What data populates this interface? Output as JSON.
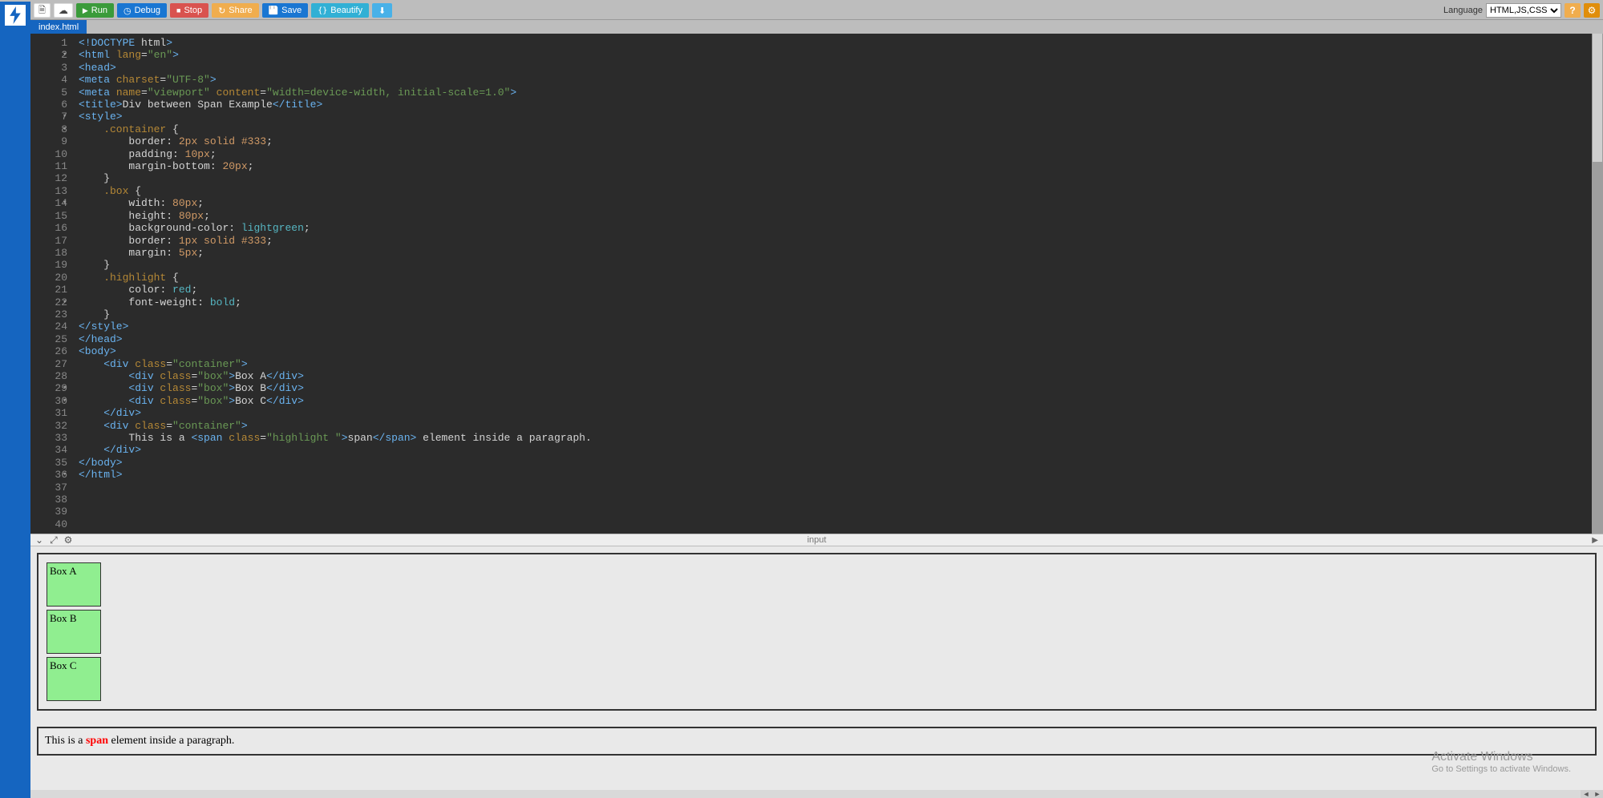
{
  "toolbar": {
    "new_label": "",
    "cloud_label": "",
    "run_label": "Run",
    "debug_label": "Debug",
    "stop_label": "Stop",
    "share_label": "Share",
    "save_label": "Save",
    "beautify_label": "Beautify",
    "download_label": "",
    "language_label": "Language",
    "language_value": "HTML,JS,CSS"
  },
  "tab": {
    "filename": "index.html"
  },
  "mid": {
    "input_label": "input"
  },
  "gutter": "1\n2\n3\n4\n5\n6\n7\n8\n9\n10\n11\n12\n13\n14\n15\n16\n17\n18\n19\n20\n21\n22\n23\n24\n25\n26\n27\n28\n29\n30\n31\n32\n33\n34\n35\n36\n37\n38\n39\n40",
  "code": {
    "l1": {
      "a": "<!DOCTYPE ",
      "b": "html",
      "c": ">"
    },
    "l2": {
      "a": "<html ",
      "b": "lang",
      "c": "=",
      "d": "\"en\"",
      "e": ">"
    },
    "l3": "<head>",
    "l4": {
      "a": "<meta ",
      "b": "charset",
      "d": "\"UTF-8\"",
      "e": ">"
    },
    "l5": {
      "a": "<meta ",
      "b": "name",
      "d": "\"viewport\"",
      "b2": "content",
      "d2": "\"width=device-width, initial-scale=1.0\"",
      "e": ">"
    },
    "l6": {
      "a": "<title>",
      "t": "Div between Span Example",
      "c": "</title>"
    },
    "l7": "<style>",
    "l8": {
      "s": "    .container ",
      "b": "{"
    },
    "l9": {
      "i": "        ",
      "p": "border",
      "v": "2px solid #333",
      "semi": ";"
    },
    "l10": {
      "i": "        ",
      "p": "padding",
      "v": "10px",
      "semi": ";"
    },
    "l11": {
      "i": "        ",
      "p": "margin-bottom",
      "v": "20px",
      "semi": ";"
    },
    "l12": "    }",
    "l13": "",
    "l14": {
      "s": "    .box ",
      "b": "{"
    },
    "l15": {
      "i": "        ",
      "p": "width",
      "v": "80px",
      "semi": ";"
    },
    "l16": {
      "i": "        ",
      "p": "height",
      "v": "80px",
      "semi": ";"
    },
    "l17": {
      "i": "        ",
      "p": "background-color",
      "v": "lightgreen",
      "semi": ";"
    },
    "l18": {
      "i": "        ",
      "p": "border",
      "v": "1px solid #333",
      "semi": ";"
    },
    "l19": {
      "i": "        ",
      "p": "margin",
      "v": "5px",
      "semi": ";"
    },
    "l20": "    }",
    "l21": "",
    "l22": {
      "s": "    .highlight ",
      "b": "{"
    },
    "l23": {
      "i": "        ",
      "p": "color",
      "v": "red",
      "semi": ";"
    },
    "l24": {
      "i": "        ",
      "p": "font-weight",
      "v": "bold",
      "semi": ";"
    },
    "l25": "    }",
    "l26": "",
    "l27": "</style>",
    "l28": "</head>",
    "l29": "<body>",
    "l30": {
      "a": "    <div ",
      "b": "class",
      "d": "\"container\"",
      "e": ">"
    },
    "l31": {
      "a": "        <div ",
      "b": "class",
      "d": "\"box\"",
      "e": ">",
      "t": "Box A",
      "c": "</div>"
    },
    "l32": {
      "a": "        <div ",
      "b": "class",
      "d": "\"box\"",
      "e": ">",
      "t": "Box B",
      "c": "</div>"
    },
    "l33": {
      "a": "        <div ",
      "b": "class",
      "d": "\"box\"",
      "e": ">",
      "t": "Box C",
      "c": "</div>"
    },
    "l34": "    </div>",
    "l35": "",
    "l36": {
      "a": "    <div ",
      "b": "class",
      "d": "\"container\"",
      "e": ">"
    },
    "l37": {
      "pre": "        This is a ",
      "a": "<span ",
      "b": "class",
      "d": "\"highlight \"",
      "e": ">",
      "t": "span",
      "c": "</span>",
      "post": " element inside a paragraph."
    },
    "l38": "    </div>",
    "l39": "</body>",
    "l40": "</html>"
  },
  "preview": {
    "boxes": [
      "Box A",
      "Box B",
      "Box C"
    ],
    "text_pre": "This is a ",
    "text_span": "span",
    "text_post": " element inside a paragraph."
  },
  "watermark": {
    "title": "Activate Windows",
    "sub": "Go to Settings to activate Windows."
  }
}
